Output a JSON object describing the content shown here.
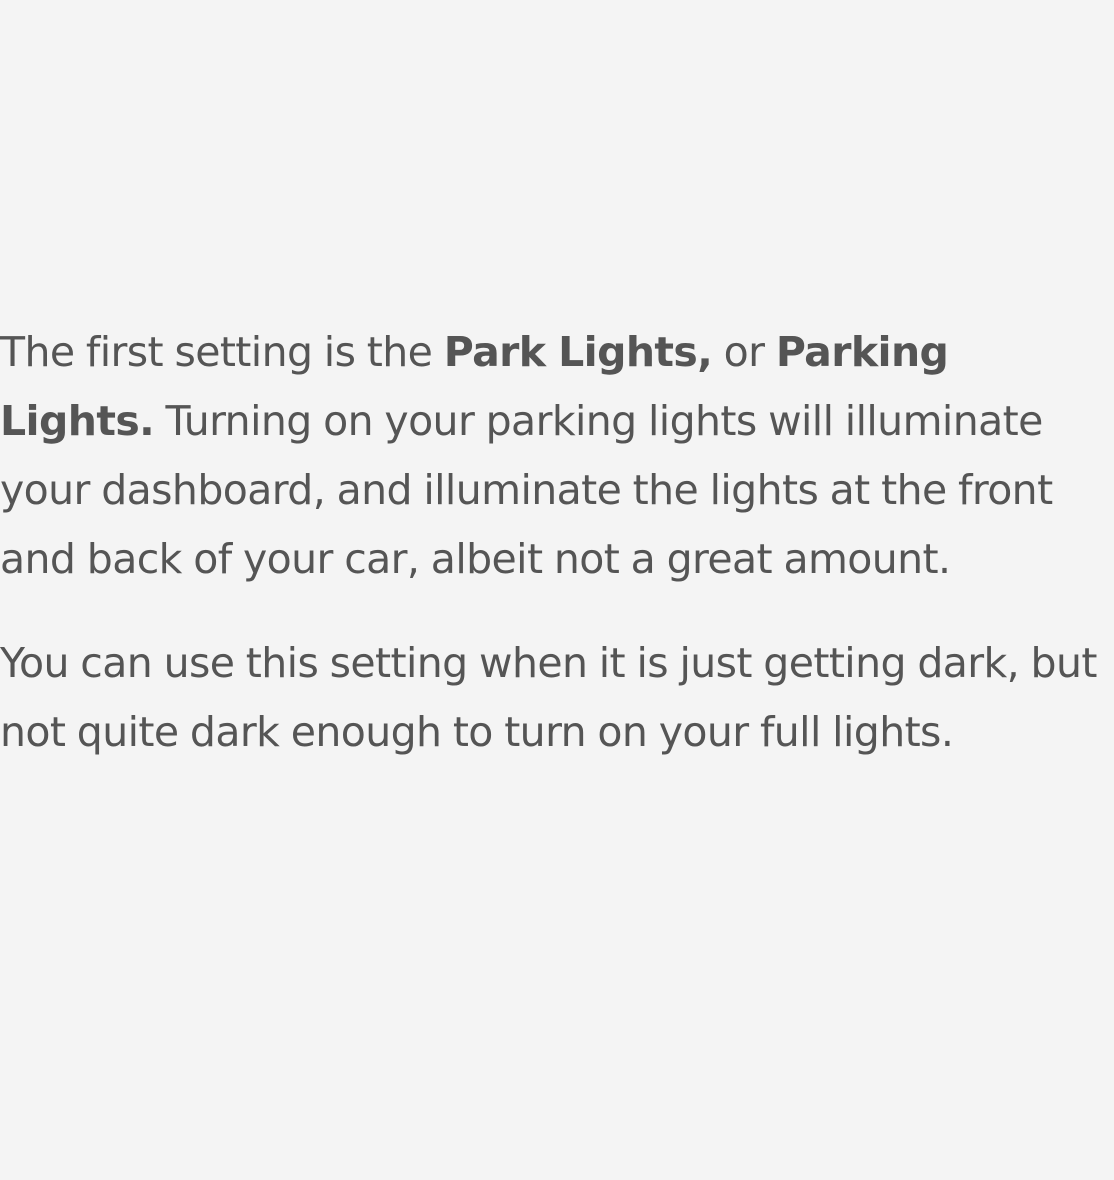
{
  "paragraph_1": {
    "intro": "The first setting is the ",
    "bold_1": "Park Lights,",
    "middle": " or ",
    "bold_2": "Parking Lights.",
    "rest": " Turning on your parking lights will illuminate your dashboard, and illuminate the lights at the front and back of your car, albeit not a great amount."
  },
  "paragraph_2": {
    "text": "You can use this setting when it is just getting dark, but not quite dark enough to turn on your full lights."
  },
  "colors": {
    "background": "#f4f4f4",
    "text": "#555555"
  }
}
